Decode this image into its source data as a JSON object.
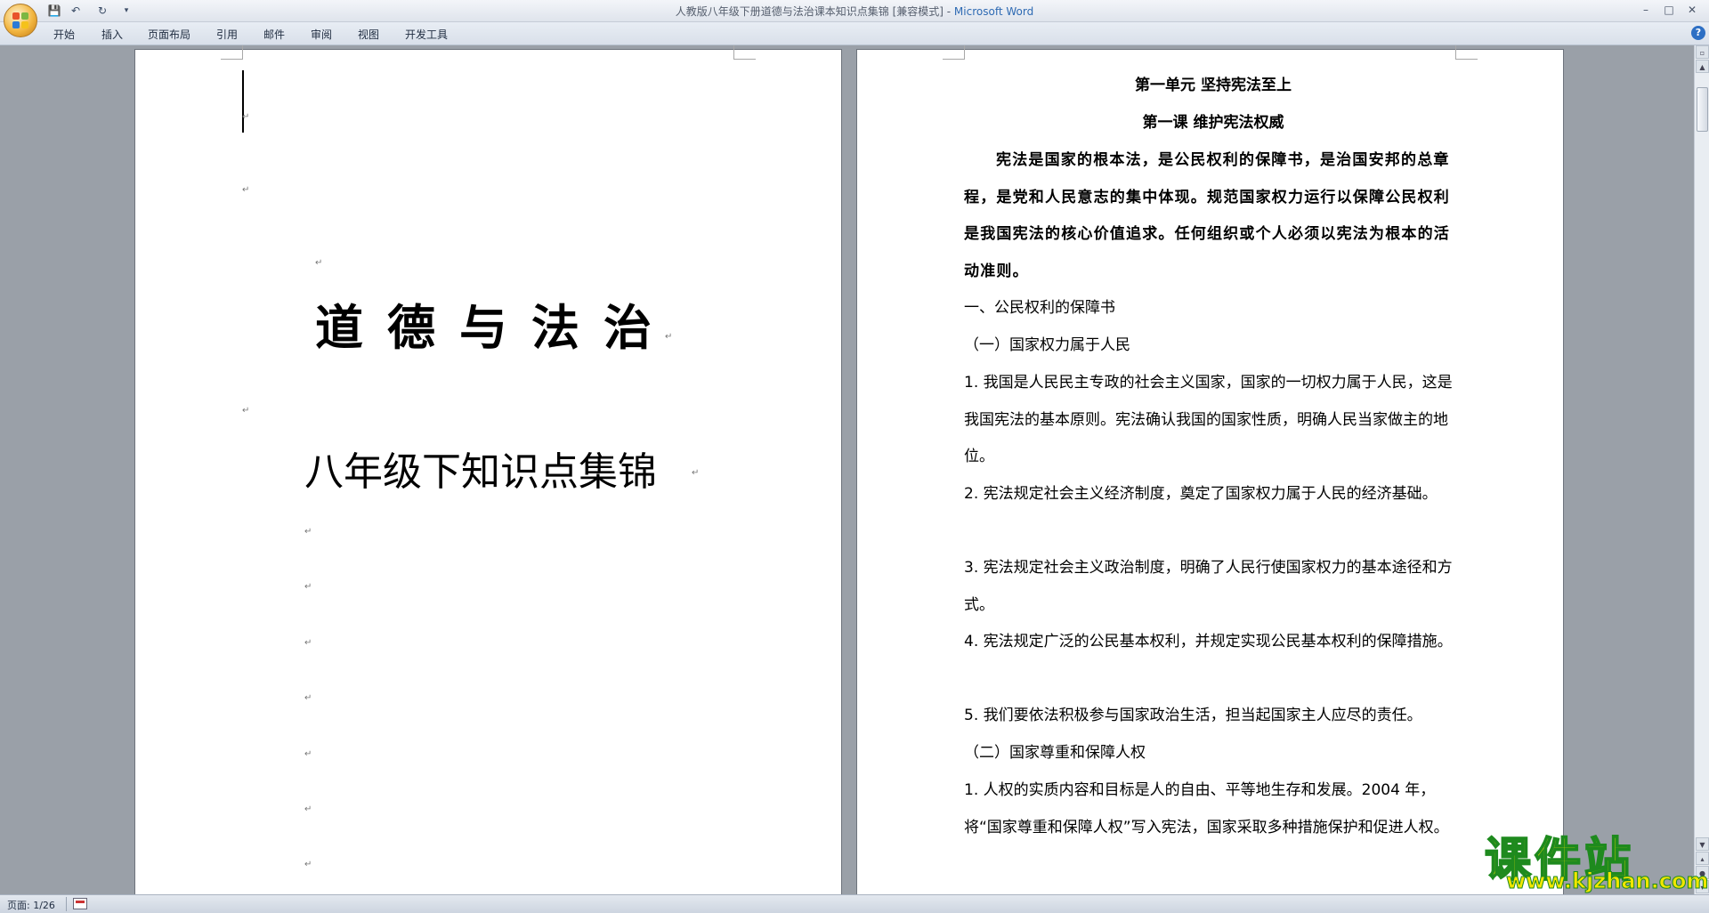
{
  "window": {
    "title_prefix": "人教版八年级下册道德与法治课本知识点集锦 [兼容模式] - ",
    "app_name": "Microsoft Word",
    "minimize": "–",
    "maximize": "□",
    "close": "✕"
  },
  "quick_access": {
    "save_icon": "💾",
    "undo_icon": "↶",
    "redo_icon": "↻",
    "more_icon": "▾"
  },
  "ribbon": {
    "tabs": [
      {
        "label": "开始"
      },
      {
        "label": "插入"
      },
      {
        "label": "页面布局"
      },
      {
        "label": "引用"
      },
      {
        "label": "邮件"
      },
      {
        "label": "审阅"
      },
      {
        "label": "视图"
      },
      {
        "label": "开发工具"
      }
    ],
    "help_icon": "?"
  },
  "page1": {
    "title": "道德与法治",
    "subtitle": "八年级下知识点集锦",
    "para_mark": "↵"
  },
  "page2": {
    "unit_heading": "第一单元 坚持宪法至上",
    "lesson_heading": "第一课 维护宪法权威",
    "intro": "宪法是国家的根本法，是公民权利的保障书，是治国安邦的总章程，是党和人民意志的集中体现。规范国家权力运行以保障公民权利是我国宪法的核心价值追求。任何组织或个人必须以宪法为根本的活动准则。",
    "section1": "一、公民权利的保障书",
    "sub1": "（一）国家权力属于人民",
    "items": [
      "1. 我国是人民民主专政的社会主义国家，国家的一切权力属于人民，这是我国宪法的基本原则。宪法确认我国的国家性质，明确人民当家做主的地位。",
      "2. 宪法规定社会主义经济制度，奠定了国家权力属于人民的经济基础。",
      "3. 宪法规定社会主义政治制度，明确了人民行使国家权力的基本途径和方式。",
      "4. 宪法规定广泛的公民基本权利，并规定实现公民基本权利的保障措施。",
      "5. 我们要依法积极参与国家政治生活，担当起国家主人应尽的责任。"
    ],
    "sub2": "（二）国家尊重和保障人权",
    "item_b1": "1. 人权的实质内容和目标是人的自由、平等地生存和发展。2004 年，将“国家尊重和保障人权”写入宪法，国家采取多种措施保护和促进人权。"
  },
  "status": {
    "page_count": "页面: 1/26"
  },
  "watermark": {
    "brand": "课件站",
    "url": "www.kjzhan.com"
  },
  "colors": {
    "workspace": "#9aa0a8",
    "app_name": "#2e6ab3",
    "watermark_fill": "#f1e600",
    "watermark_stroke": "#1e8a1e"
  }
}
